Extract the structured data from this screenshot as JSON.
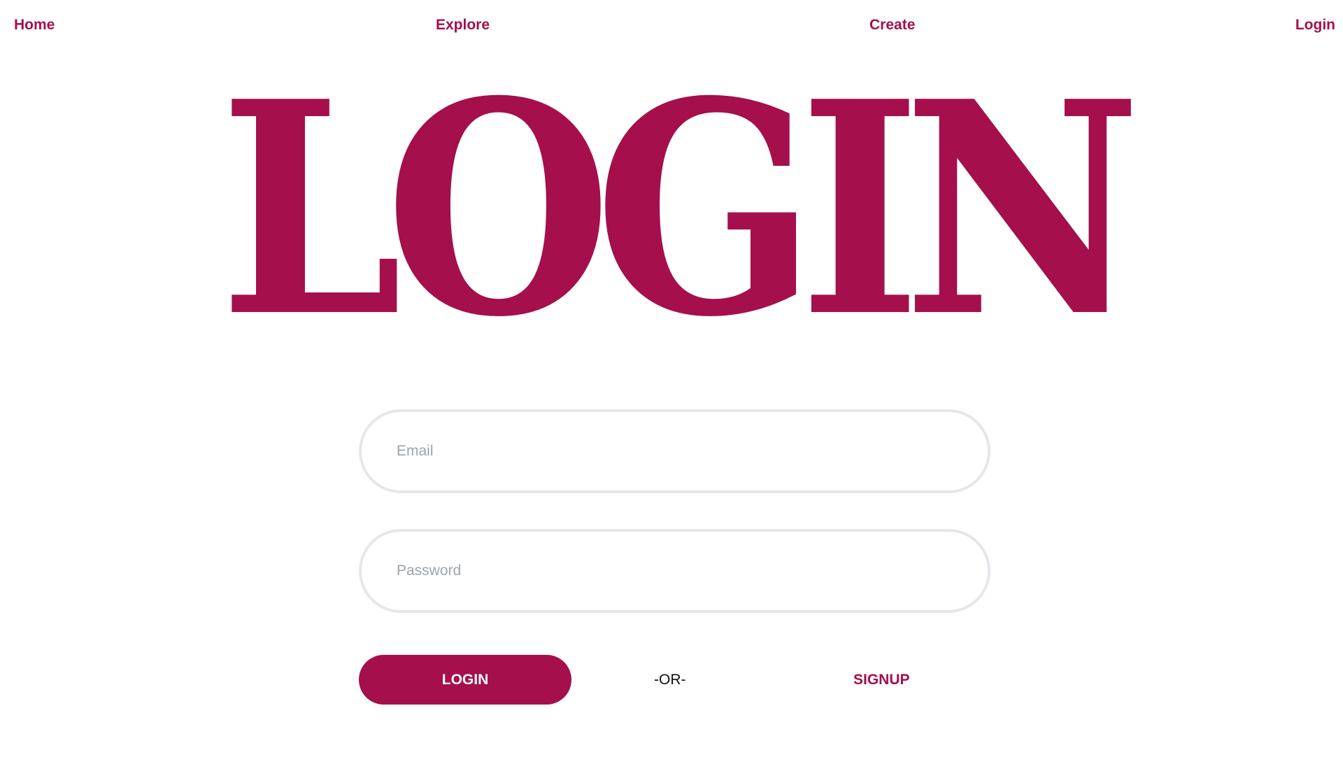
{
  "nav": {
    "home_label": "Home",
    "explore_label": "Explore",
    "create_label": "Create",
    "login_label": "Login"
  },
  "hero": {
    "title": "LOGIN"
  },
  "form": {
    "email_placeholder": "Email",
    "email_value": "",
    "password_placeholder": "Password",
    "password_value": "",
    "login_button_label": "LOGIN",
    "or_text": "-OR-",
    "signup_label": "SIGNUP"
  },
  "colors": {
    "brand": "#a50f4b",
    "input_border": "#e5e7eb",
    "placeholder": "#9ca3af",
    "background": "#ffffff"
  }
}
